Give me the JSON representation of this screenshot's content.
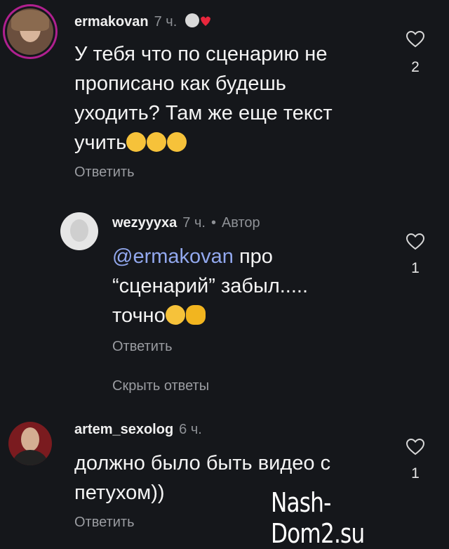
{
  "comments": [
    {
      "username": "ermakovan",
      "time": "7 ч.",
      "lines": [
        "У тебя что по сценарию не",
        "прописано как будешь",
        "уходить? Там же еще текст",
        "учить"
      ],
      "emojis": [
        "😂",
        "😂",
        "😂"
      ],
      "reply_label": "Ответить",
      "likes": "2"
    },
    {
      "username": "wezyyyxa",
      "time": "7 ч.",
      "dot": "•",
      "author_badge": "Автор",
      "mention": "@ermakovan",
      "lines": [
        " про",
        "“сценарий” забыл.....",
        "точно"
      ],
      "emojis": [
        "🤣",
        "👏"
      ],
      "reply_label": "Ответить",
      "hide_replies_label": "Скрыть ответы",
      "likes": "1"
    },
    {
      "username": "artem_sexolog",
      "time": "6 ч.",
      "lines": [
        "должно было быть видео с",
        "петухом))"
      ],
      "reply_label": "Ответить",
      "likes": "1"
    }
  ],
  "watermark": "Nash-Dom2.su",
  "icons": {
    "like": "heart-outline-icon",
    "badge": "heart-red-icon"
  },
  "colors": {
    "background": "#15171b",
    "mention": "#92a8ee",
    "muted": "#8e9196",
    "story_ring": "#b0208f"
  }
}
